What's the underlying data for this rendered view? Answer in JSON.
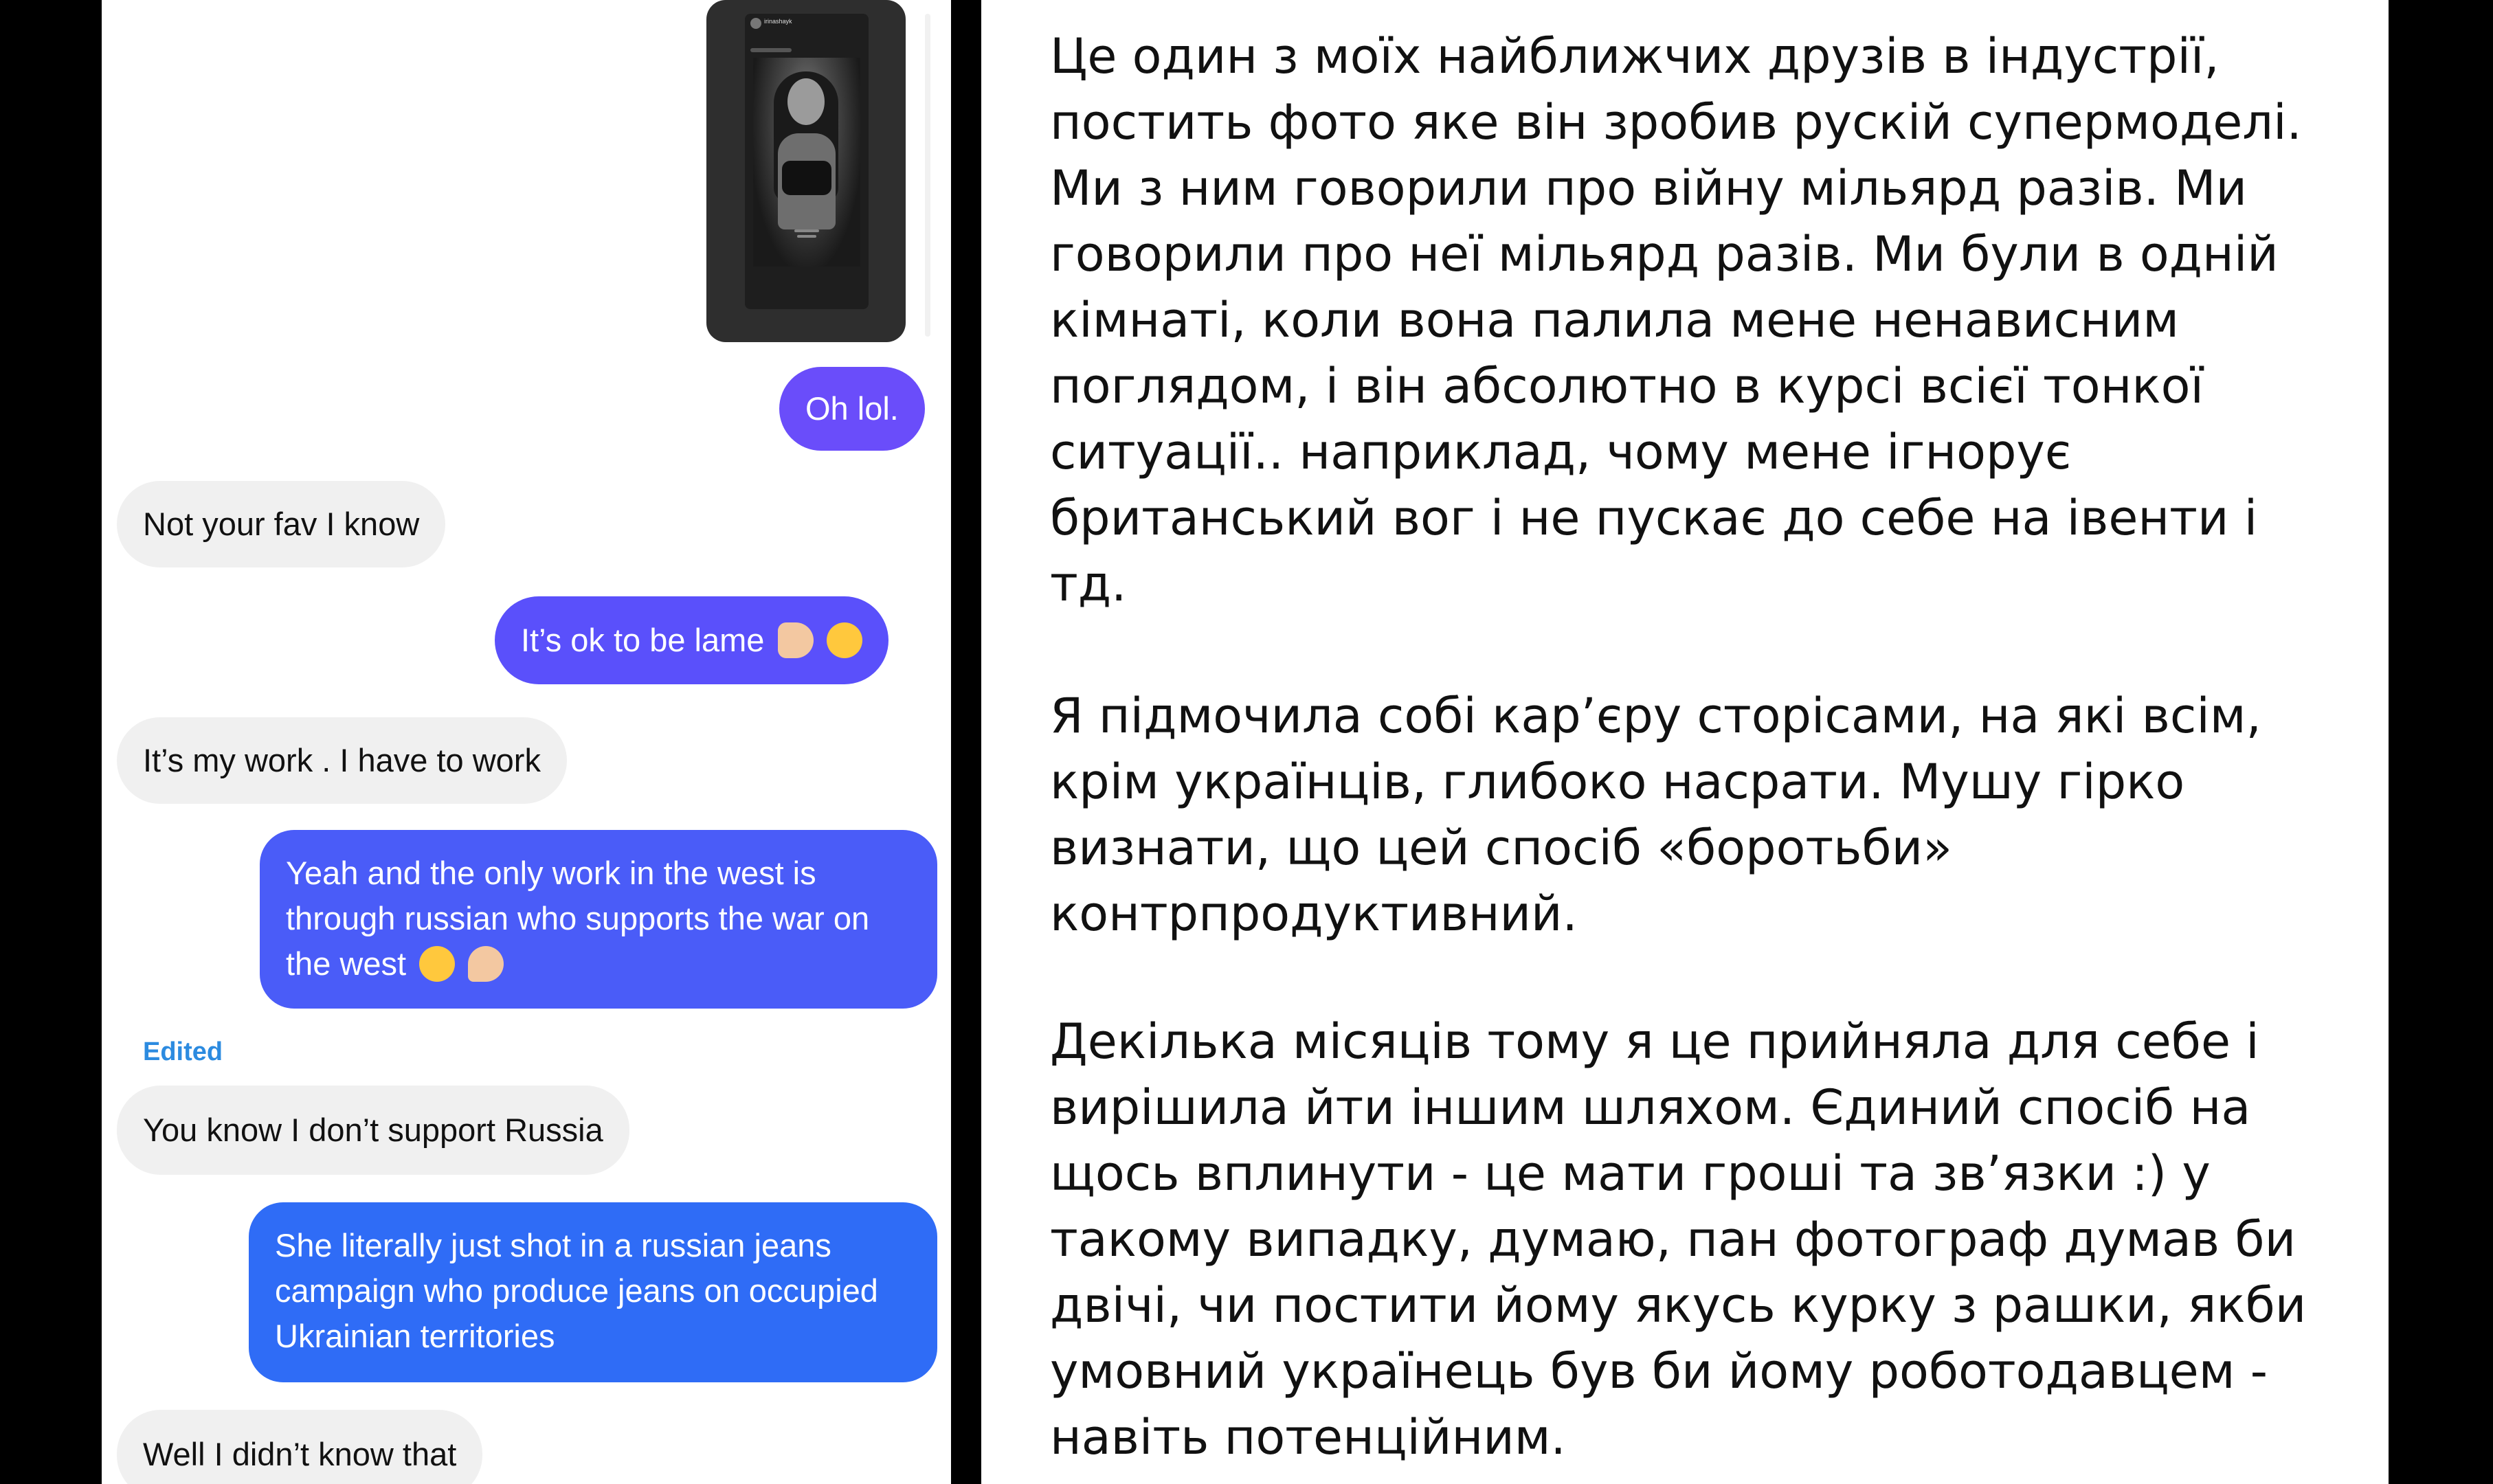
{
  "chat": {
    "story": {
      "username": "irinashayk"
    },
    "messages": [
      {
        "direction": "out",
        "text": "Oh lol."
      },
      {
        "direction": "in",
        "text": "Not your fav I know"
      },
      {
        "direction": "out",
        "text": "It’s ok to be lame"
      },
      {
        "direction": "in",
        "text": "It’s my work . I have to work"
      },
      {
        "direction": "out",
        "text": "Yeah and the only work in the west is through russian who supports the war on the west"
      },
      {
        "direction": "in",
        "text": "You know I don’t support Russia"
      },
      {
        "direction": "out",
        "text": "She literally just shot in a russian jeans campaign who produce jeans on occupied Ukrainian territories"
      },
      {
        "direction": "in",
        "text": "Well I didn’t know that"
      }
    ],
    "edited_label": "Edited",
    "colors": {
      "outgoing": "#6a4dfa",
      "outgoing_blue": "#2f6cf6",
      "incoming": "#f0f0f0",
      "edited": "#2c8be0"
    }
  },
  "post": {
    "paragraphs": [
      "Це один з моїх найближчих друзів в індустрії, постить фото яке він зробив рускій супермоделі. Ми з ним говорили про війну мільярд разів. Ми говорили про неї мільярд разів. Ми були в одній кімнаті, коли вона палила мене ненависним поглядом, і він абсолютно в курсі всієї тонкої ситуації.. наприклад, чому мене ігнорує британський вог і не пускає до себе на івенти і тд.",
      "Я підмочила собі кар’єру  сторісами, на які всім, крім українців, глибоко насрати. Мушу гірко визнати, що цей спосіб «боротьби» контрпродуктивний.",
      "Декілька місяців тому я це прийняла для себе і вирішила йти іншим шляхом. Єдиний спосіб на щось вплинути - це мати гроші та зв’язки :) у такому випадку, думаю, пан фотограф думав би двічі, чи постити йому якусь курку з рашки, якби умовний українець був би йому роботодавцем - навіть потенційним."
    ]
  }
}
